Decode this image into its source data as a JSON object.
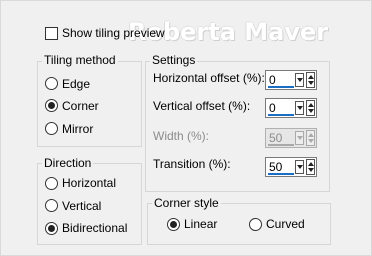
{
  "watermark": "Roberta Maver",
  "show_tiling_preview": {
    "label": "Show tiling preview",
    "checked": false
  },
  "tiling_method": {
    "title": "Tiling method",
    "options": [
      "Edge",
      "Corner",
      "Mirror"
    ],
    "selected": "Corner"
  },
  "direction": {
    "title": "Direction",
    "options": [
      "Horizontal",
      "Vertical",
      "Bidirectional"
    ],
    "selected": "Bidirectional"
  },
  "settings": {
    "title": "Settings",
    "horizontal_offset": {
      "label": "Horizontal offset (%):",
      "value": "0"
    },
    "vertical_offset": {
      "label": "Vertical offset (%):",
      "value": "0"
    },
    "width": {
      "label": "Width (%):",
      "value": "50",
      "disabled": true
    },
    "transition": {
      "label": "Transition (%):",
      "value": "50"
    }
  },
  "corner_style": {
    "title": "Corner style",
    "options": [
      "Linear",
      "Curved"
    ],
    "selected": "Linear"
  },
  "colors": {
    "accent_underline": "#1a6fc4",
    "background": "#f0f0f0"
  }
}
